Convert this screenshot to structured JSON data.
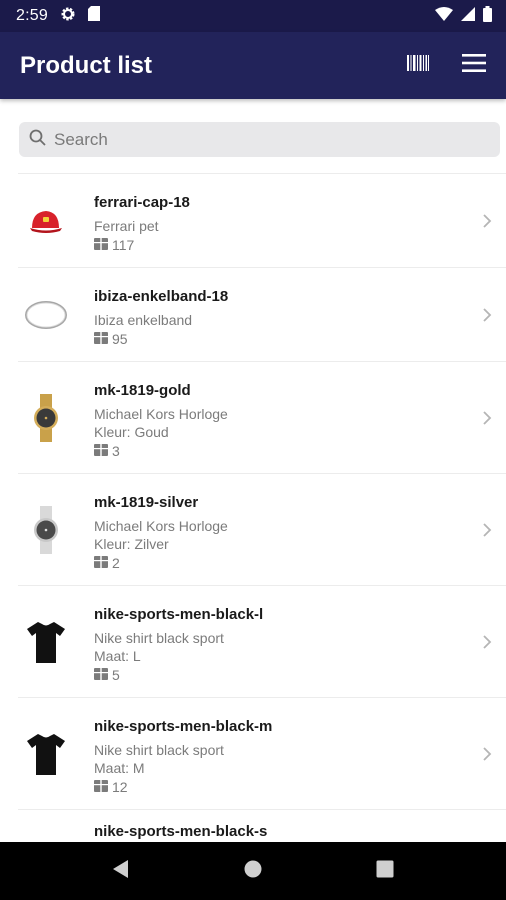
{
  "status_bar": {
    "time": "2:59",
    "icons": [
      "gear-icon",
      "sd-card-icon",
      "wifi-icon",
      "signal-icon",
      "battery-icon"
    ]
  },
  "app_bar": {
    "title": "Product list",
    "actions": [
      "barcode-icon",
      "menu-icon"
    ]
  },
  "search": {
    "placeholder": "Search",
    "value": ""
  },
  "products": [
    {
      "sku": "ferrari-cap-18",
      "name": "Ferrari pet",
      "variant": "",
      "stock": "117",
      "image": "red-cap"
    },
    {
      "sku": "ibiza-enkelband-18",
      "name": "Ibiza enkelband",
      "variant": "",
      "stock": "95",
      "image": "anklet"
    },
    {
      "sku": "mk-1819-gold",
      "name": "Michael Kors Horloge",
      "variant": "Kleur: Goud",
      "stock": "3",
      "image": "gold-watch"
    },
    {
      "sku": "mk-1819-silver",
      "name": "Michael Kors Horloge",
      "variant": "Kleur: Zilver",
      "stock": "2",
      "image": "silver-watch"
    },
    {
      "sku": "nike-sports-men-black-l",
      "name": "Nike shirt black sport",
      "variant": "Maat: L",
      "stock": "5",
      "image": "black-tshirt"
    },
    {
      "sku": "nike-sports-men-black-m",
      "name": "Nike shirt black sport",
      "variant": "Maat: M",
      "stock": "12",
      "image": "black-tshirt"
    },
    {
      "sku": "nike-sports-men-black-s",
      "name": "",
      "variant": "",
      "stock": "",
      "image": ""
    }
  ],
  "colors": {
    "status_bar": "#1b1a4a",
    "app_bar": "#22235a",
    "search_bg": "#e8e8ea",
    "secondary_text": "#7b7b7b"
  }
}
